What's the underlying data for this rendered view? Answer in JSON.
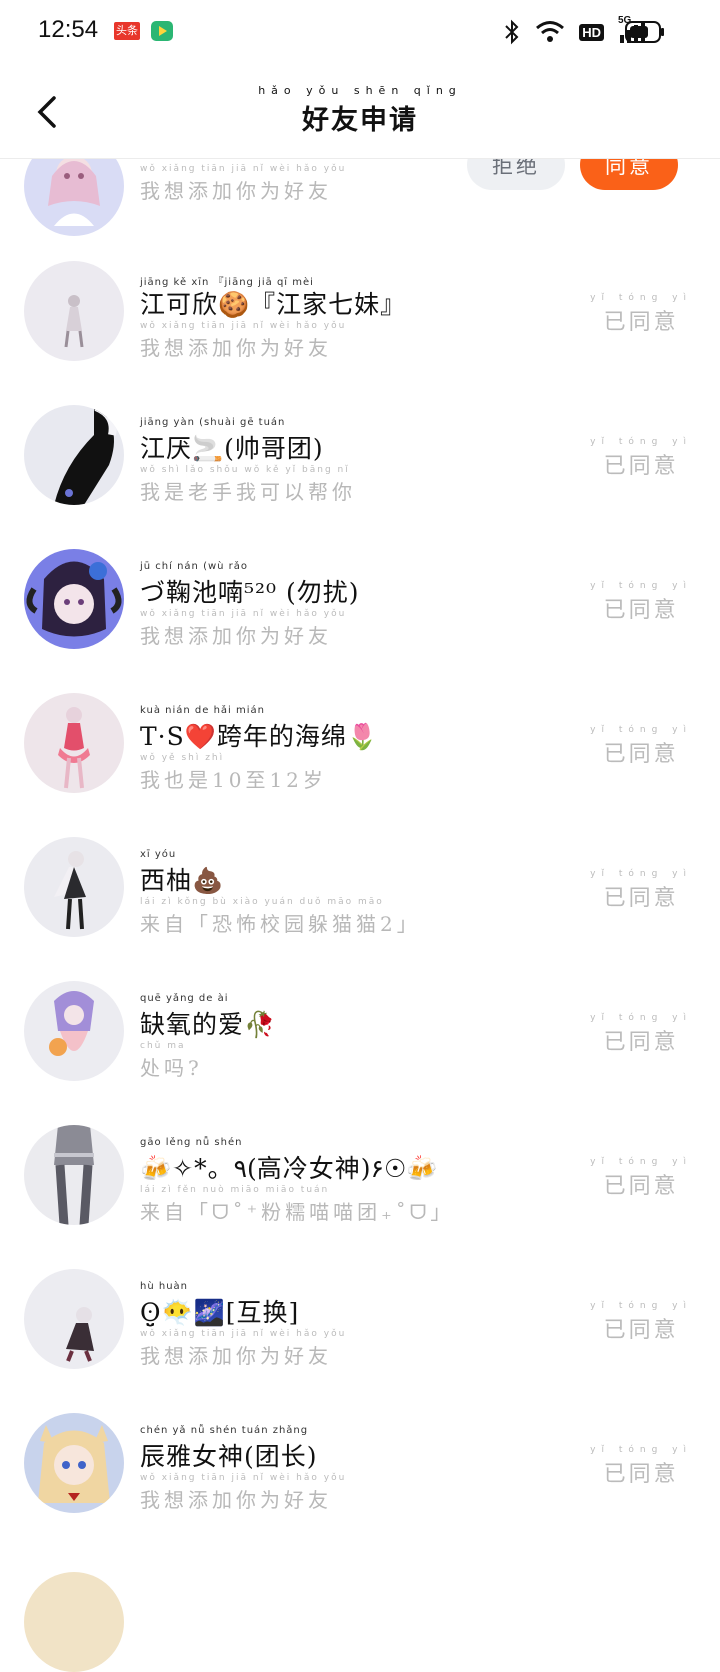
{
  "status_bar": {
    "time": "12:54",
    "app1": "头条",
    "network": "5G",
    "hd": "HD"
  },
  "header": {
    "title_pinyin": "hǎo yǒu shēn qǐng",
    "title": "好友申请"
  },
  "top_item": {
    "message_pinyin": "wǒ xiǎng tiān jiā nǐ wèi hǎo yǒu",
    "message": "我想添加你为好友",
    "reject_label": "拒绝",
    "agree_label": "同意"
  },
  "status_pinyin": "yǐ tóng yì",
  "status_label": "已同意",
  "items": [
    {
      "name_pinyin": "jiāng kě xīn     『jiāng jiā qī mèi",
      "name": "江可欣🍪『江家七妹』",
      "msg_pinyin": "wǒ xiǎng tiān jiā nǐ wèi hǎo yǒu",
      "message": "我想添加你为好友"
    },
    {
      "name_pinyin": "jiāng yàn    (shuài gē tuán",
      "name": "江厌🚬(帅哥团)",
      "msg_pinyin": "wǒ shì lǎo shǒu wǒ kě yǐ bāng nǐ",
      "message": "我是老手我可以帮你"
    },
    {
      "name_pinyin": "    jū chí nán      (wù rǎo",
      "name": "づ鞠池喃⁵²⁰ (勿扰)",
      "msg_pinyin": "wǒ xiǎng tiān jiā nǐ wèi hǎo yǒu",
      "message": "我想添加你为好友"
    },
    {
      "name_pinyin": "          kuà nián de hǎi mián",
      "name": "T·S❤️跨年的海绵🌷",
      "msg_pinyin": "wǒ yě shì    zhì",
      "message": "我也是10至12岁"
    },
    {
      "name_pinyin": "xī yóu",
      "name": "西柚💩",
      "msg_pinyin": "lái zì  kǒng bù xiào yuán duǒ māo māo",
      "message": "来自「恐怖校园躲猫猫2」"
    },
    {
      "name_pinyin": "quē yǎng de ài",
      "name": "缺氧的爱🥀",
      "msg_pinyin": "chǔ ma",
      "message": "处吗?"
    },
    {
      "name_pinyin": "              gāo lěng nǚ shén",
      "name": "🍻✧*。٩(高冷女神)۶☉🍻",
      "msg_pinyin": "lái zì        fěn nuò miāo miāo tuán",
      "message": "来自「ᗜ˚⁺粉糯喵喵团₊˚ᗜ」"
    },
    {
      "name_pinyin": "              hù huàn",
      "name": "ʘ̤̮😶‍🌫️🌌[互换]",
      "msg_pinyin": "wǒ xiǎng tiān jiā nǐ wèi hǎo yǒu",
      "message": "我想添加你为好友"
    },
    {
      "name_pinyin": "chén yǎ nǚ shén tuán zhǎng",
      "name": "辰雅女神(团长)",
      "msg_pinyin": "wǒ xiǎng tiān jiā nǐ wèi hǎo yǒu",
      "message": "我想添加你为好友"
    }
  ]
}
